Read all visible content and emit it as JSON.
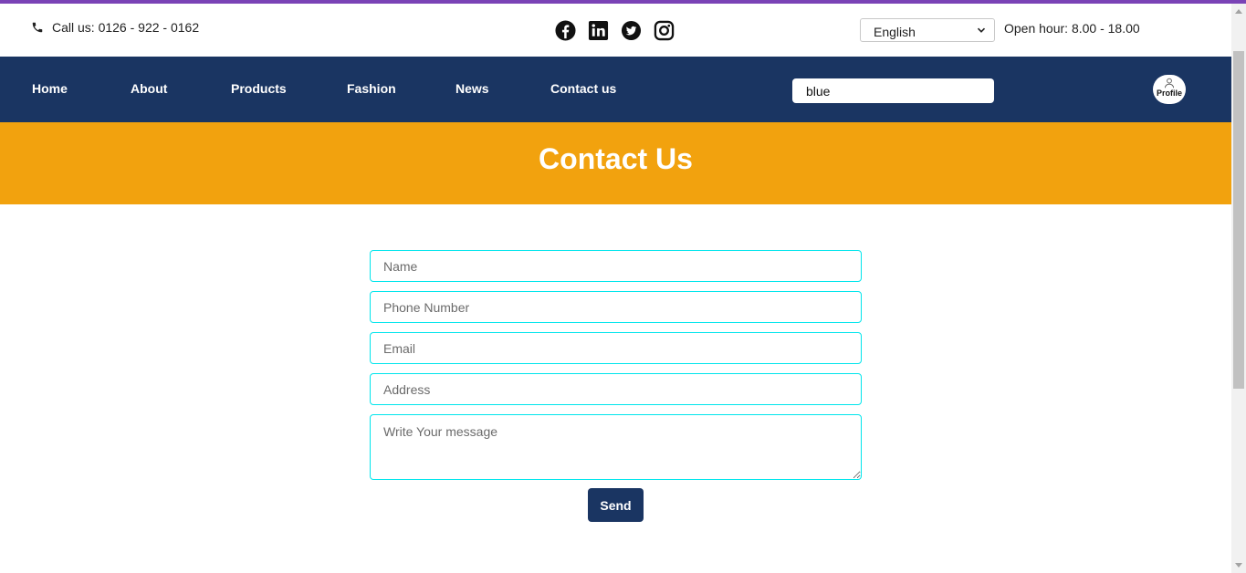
{
  "topbar": {
    "call_text": "Call us: 0126 - 922 - 0162",
    "social_icons": [
      "facebook-icon",
      "linkedin-icon",
      "twitter-icon",
      "instagram-icon"
    ],
    "language_selected": "English",
    "open_hour": "Open hour: 8.00 - 18.00"
  },
  "nav": {
    "items": [
      {
        "label": "Home"
      },
      {
        "label": "About"
      },
      {
        "label": "Products"
      },
      {
        "label": "Fashion"
      },
      {
        "label": "News"
      },
      {
        "label": "Contact us"
      }
    ],
    "search_value": "blue",
    "profile_label": "Profile"
  },
  "banner": {
    "title": "Contact Us"
  },
  "form": {
    "name_placeholder": "Name",
    "phone_placeholder": "Phone Number",
    "email_placeholder": "Email",
    "address_placeholder": "Address",
    "message_placeholder": "Write Your message",
    "send_label": "Send"
  },
  "colors": {
    "accent_bar": "#7a43b6",
    "navbar": "#1a3562",
    "banner": "#f2a20e",
    "field_border": "#00e5ec",
    "send_button": "#1a3562"
  }
}
